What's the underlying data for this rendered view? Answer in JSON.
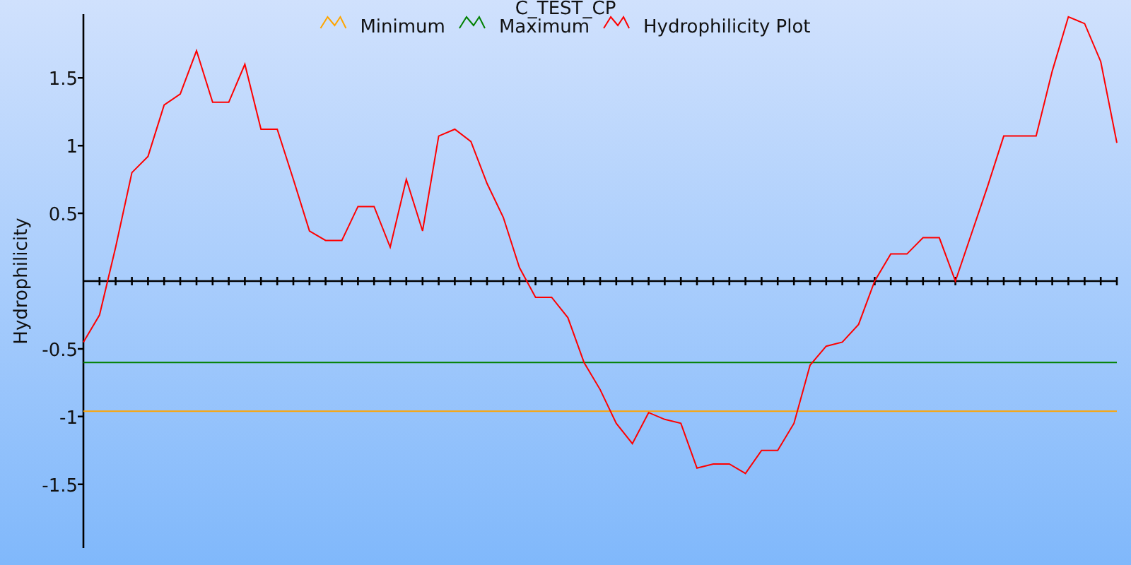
{
  "chart_data": {
    "type": "line",
    "title": "C_TEST_CP",
    "legend": true,
    "ylabel": "Hydrophilicity",
    "ylim": [
      -1.97,
      1.97
    ],
    "yticks": [
      -1.5,
      -1,
      -0.5,
      0.5,
      1,
      1.5
    ],
    "series": [
      {
        "name": "Minimum",
        "color": "#ffa500",
        "values": [
          -0.96,
          -0.96,
          -0.96,
          -0.96,
          -0.96,
          -0.96,
          -0.96,
          -0.96,
          -0.96,
          -0.96,
          -0.96,
          -0.96,
          -0.96,
          -0.96,
          -0.96,
          -0.96,
          -0.96,
          -0.96,
          -0.96,
          -0.96,
          -0.96,
          -0.96,
          -0.96,
          -0.96,
          -0.96,
          -0.96,
          -0.96,
          -0.96,
          -0.96,
          -0.96,
          -0.96,
          -0.96,
          -0.96,
          -0.96,
          -0.96,
          -0.96,
          -0.96,
          -0.96,
          -0.96,
          -0.96,
          -0.96,
          -0.96,
          -0.96,
          -0.96,
          -0.96,
          -0.96,
          -0.96,
          -0.96,
          -0.96,
          -0.96,
          -0.96,
          -0.96,
          -0.96,
          -0.96,
          -0.96,
          -0.96,
          -0.96,
          -0.96,
          -0.96,
          -0.96,
          -0.96,
          -0.96,
          -0.96,
          -0.96,
          -0.96
        ]
      },
      {
        "name": "Maximum",
        "color": "#008000",
        "values": [
          -0.6,
          -0.6,
          -0.6,
          -0.6,
          -0.6,
          -0.6,
          -0.6,
          -0.6,
          -0.6,
          -0.6,
          -0.6,
          -0.6,
          -0.6,
          -0.6,
          -0.6,
          -0.6,
          -0.6,
          -0.6,
          -0.6,
          -0.6,
          -0.6,
          -0.6,
          -0.6,
          -0.6,
          -0.6,
          -0.6,
          -0.6,
          -0.6,
          -0.6,
          -0.6,
          -0.6,
          -0.6,
          -0.6,
          -0.6,
          -0.6,
          -0.6,
          -0.6,
          -0.6,
          -0.6,
          -0.6,
          -0.6,
          -0.6,
          -0.6,
          -0.6,
          -0.6,
          -0.6,
          -0.6,
          -0.6,
          -0.6,
          -0.6,
          -0.6,
          -0.6,
          -0.6,
          -0.6,
          -0.6,
          -0.6,
          -0.6,
          -0.6,
          -0.6,
          -0.6,
          -0.6,
          -0.6,
          -0.6,
          -0.6,
          -0.6
        ]
      },
      {
        "name": "Hydrophilicity Plot",
        "color": "#ff0000",
        "values": [
          -0.45,
          -0.25,
          0.25,
          0.8,
          0.92,
          1.3,
          1.38,
          1.7,
          1.32,
          1.32,
          1.6,
          1.12,
          1.12,
          0.75,
          0.37,
          0.3,
          0.3,
          0.55,
          0.55,
          0.25,
          0.75,
          0.37,
          1.07,
          1.12,
          1.03,
          0.72,
          0.47,
          0.1,
          -0.12,
          -0.12,
          -0.27,
          -0.6,
          -0.8,
          -1.05,
          -1.2,
          -0.97,
          -1.02,
          -1.05,
          -1.38,
          -1.35,
          -1.35,
          -1.42,
          -1.25,
          -1.25,
          -1.05,
          -0.62,
          -0.48,
          -0.45,
          -0.32,
          0,
          0.2,
          0.2,
          0.32,
          0.32,
          0,
          0.35,
          0.7,
          1.07,
          1.07,
          1.07,
          1.55,
          1.95,
          1.9,
          1.62,
          1.02
        ]
      }
    ]
  }
}
